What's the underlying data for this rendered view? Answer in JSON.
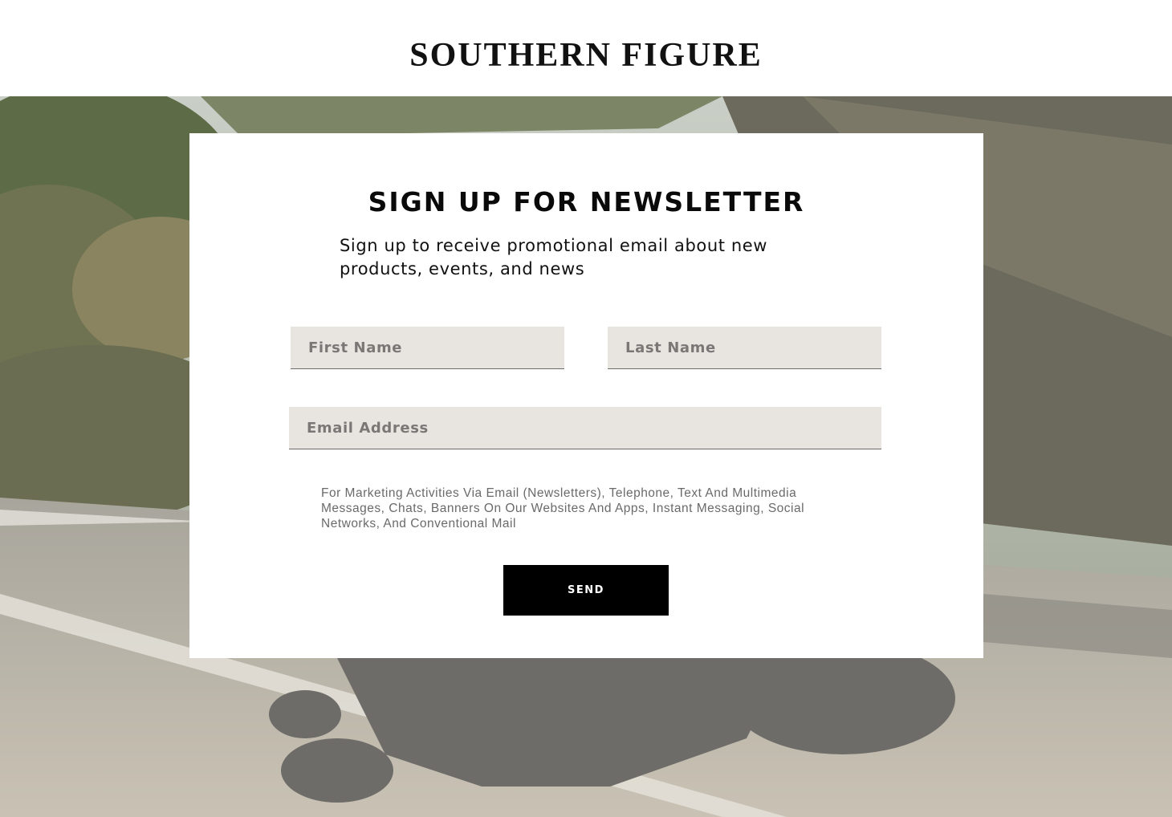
{
  "header": {
    "brand": "SOUTHERN FIGURE"
  },
  "newsletter": {
    "title": "SIGN UP FOR NEWSLETTER",
    "subtitle": "Sign up to receive promotional email about new products, events, and news",
    "first_name_placeholder": "First Name",
    "last_name_placeholder": "Last Name",
    "email_placeholder": "Email Address",
    "consent_text": "For Marketing Activities Via Email (Newsletters), Telephone, Text And Multimedia Messages, Chats, Banners On Our Websites And Apps, Instant Messaging, Social Networks, And Conventional Mail",
    "send_label": "SEND"
  },
  "colors": {
    "input_background": "#e8e4df",
    "button_background": "#000000",
    "button_text": "#ffffff"
  }
}
